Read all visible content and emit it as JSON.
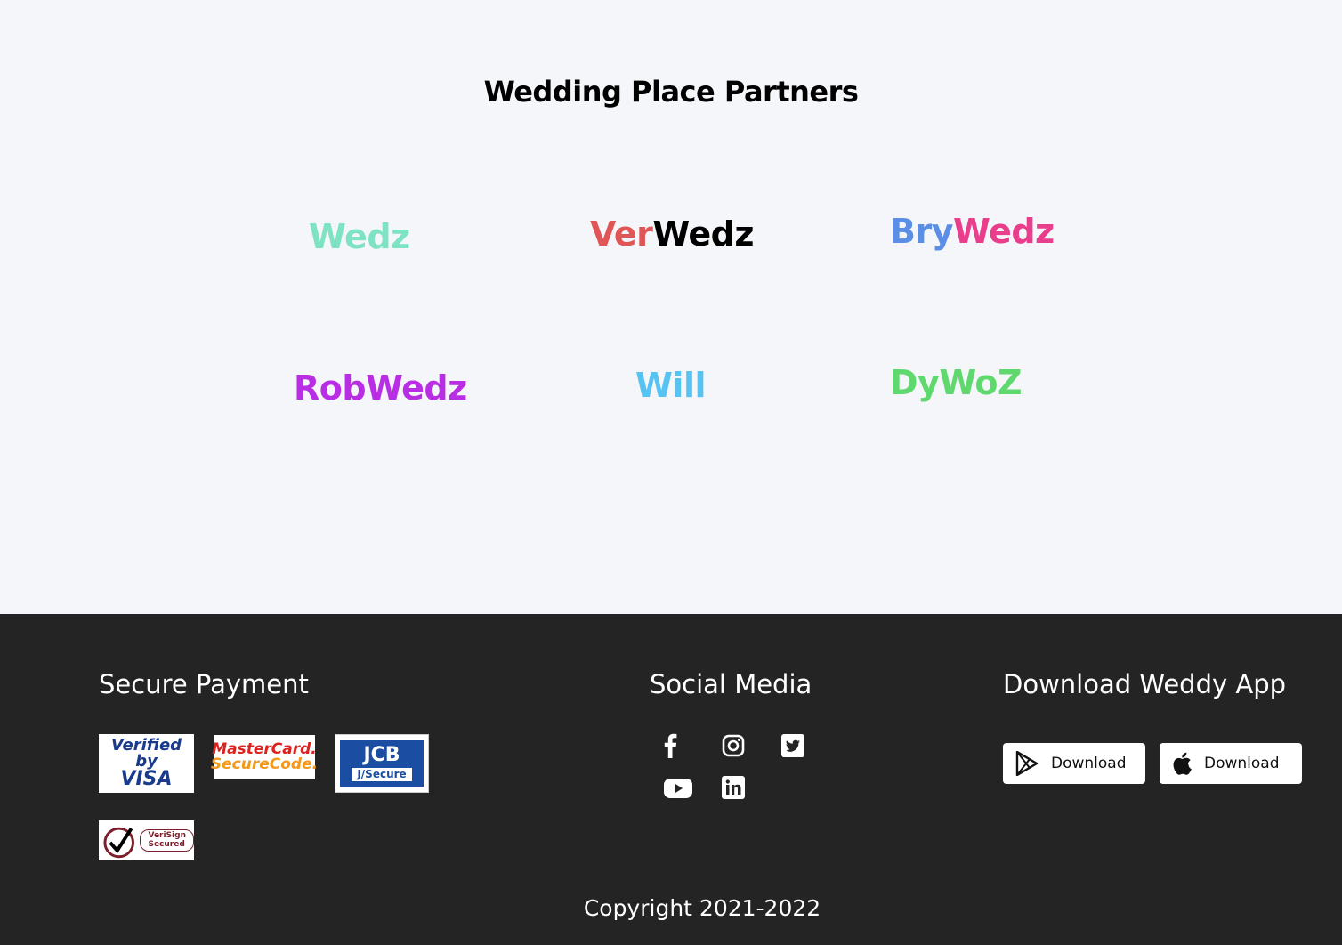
{
  "partners": {
    "title": "Wedding Place Partners",
    "logos": [
      {
        "parts": [
          {
            "text": "Wedz",
            "color": "#7de3c3"
          }
        ]
      },
      {
        "parts": [
          {
            "text": "Ver",
            "color": "#e05656"
          },
          {
            "text": "Wedz",
            "color": "#000000"
          }
        ]
      },
      {
        "parts": [
          {
            "text": "Bry",
            "color": "#5b8fe6"
          },
          {
            "text": "Wedz",
            "color": "#e83e8c"
          }
        ]
      },
      {
        "parts": [
          {
            "text": "RobWedz",
            "color": "#b92ee4"
          }
        ]
      },
      {
        "parts": [
          {
            "text": "Will",
            "color": "#56c3f2"
          }
        ]
      },
      {
        "parts": [
          {
            "text": "DyWoZ",
            "color": "#5fd86e"
          }
        ]
      }
    ]
  },
  "footer": {
    "secure_payment": {
      "heading": "Secure Payment",
      "badges": {
        "visa": {
          "line1": "Verified by",
          "line2": "VISA"
        },
        "mastercard": {
          "line1": "MasterCard.",
          "line2": "SecureCode."
        },
        "jcb": {
          "line1": "JCB",
          "line2": "J/Secure"
        },
        "verisign": {
          "line1": "VeriSign",
          "line2": "Secured"
        }
      }
    },
    "social_media": {
      "heading": "Social Media",
      "icons": [
        "facebook-icon",
        "instagram-icon",
        "twitter-icon",
        "youtube-icon",
        "linkedin-icon"
      ]
    },
    "download_app": {
      "heading": "Download Weddy App",
      "google_play_label": "Download",
      "app_store_label": "Download"
    },
    "copyright": "Copyright 2021-2022"
  },
  "colors": {
    "footer_bg": "#242424",
    "page_bg": "#f4f6fa"
  }
}
